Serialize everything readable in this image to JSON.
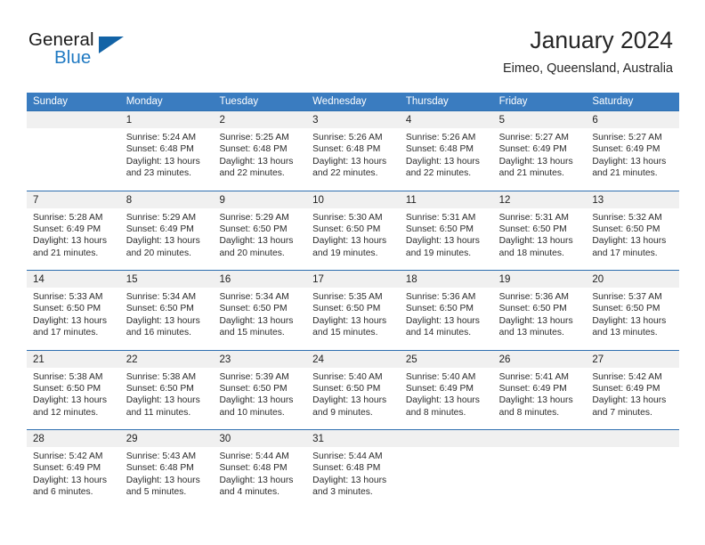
{
  "brand": {
    "word1": "General",
    "word2": "Blue",
    "flag_icon": "triangle-flag-icon",
    "colors": {
      "blue": "#1f79c2",
      "dark_blue": "#1263a6"
    }
  },
  "header": {
    "title": "January 2024",
    "subtitle": "Eimeo, Queensland, Australia"
  },
  "theme": {
    "header_blue": "#3a7cc0",
    "row_border_blue": "#2e6fb0",
    "day_head_gray": "#f0f0f0"
  },
  "weekdays": [
    "Sunday",
    "Monday",
    "Tuesday",
    "Wednesday",
    "Thursday",
    "Friday",
    "Saturday"
  ],
  "weeks": [
    [
      {
        "day": "",
        "sunrise": "",
        "sunset": "",
        "daylight_line1": "",
        "daylight_line2": "",
        "empty": true
      },
      {
        "day": "1",
        "sunrise": "Sunrise: 5:24 AM",
        "sunset": "Sunset: 6:48 PM",
        "daylight_line1": "Daylight: 13 hours",
        "daylight_line2": "and 23 minutes."
      },
      {
        "day": "2",
        "sunrise": "Sunrise: 5:25 AM",
        "sunset": "Sunset: 6:48 PM",
        "daylight_line1": "Daylight: 13 hours",
        "daylight_line2": "and 22 minutes."
      },
      {
        "day": "3",
        "sunrise": "Sunrise: 5:26 AM",
        "sunset": "Sunset: 6:48 PM",
        "daylight_line1": "Daylight: 13 hours",
        "daylight_line2": "and 22 minutes."
      },
      {
        "day": "4",
        "sunrise": "Sunrise: 5:26 AM",
        "sunset": "Sunset: 6:48 PM",
        "daylight_line1": "Daylight: 13 hours",
        "daylight_line2": "and 22 minutes."
      },
      {
        "day": "5",
        "sunrise": "Sunrise: 5:27 AM",
        "sunset": "Sunset: 6:49 PM",
        "daylight_line1": "Daylight: 13 hours",
        "daylight_line2": "and 21 minutes."
      },
      {
        "day": "6",
        "sunrise": "Sunrise: 5:27 AM",
        "sunset": "Sunset: 6:49 PM",
        "daylight_line1": "Daylight: 13 hours",
        "daylight_line2": "and 21 minutes."
      }
    ],
    [
      {
        "day": "7",
        "sunrise": "Sunrise: 5:28 AM",
        "sunset": "Sunset: 6:49 PM",
        "daylight_line1": "Daylight: 13 hours",
        "daylight_line2": "and 21 minutes."
      },
      {
        "day": "8",
        "sunrise": "Sunrise: 5:29 AM",
        "sunset": "Sunset: 6:49 PM",
        "daylight_line1": "Daylight: 13 hours",
        "daylight_line2": "and 20 minutes."
      },
      {
        "day": "9",
        "sunrise": "Sunrise: 5:29 AM",
        "sunset": "Sunset: 6:50 PM",
        "daylight_line1": "Daylight: 13 hours",
        "daylight_line2": "and 20 minutes."
      },
      {
        "day": "10",
        "sunrise": "Sunrise: 5:30 AM",
        "sunset": "Sunset: 6:50 PM",
        "daylight_line1": "Daylight: 13 hours",
        "daylight_line2": "and 19 minutes."
      },
      {
        "day": "11",
        "sunrise": "Sunrise: 5:31 AM",
        "sunset": "Sunset: 6:50 PM",
        "daylight_line1": "Daylight: 13 hours",
        "daylight_line2": "and 19 minutes."
      },
      {
        "day": "12",
        "sunrise": "Sunrise: 5:31 AM",
        "sunset": "Sunset: 6:50 PM",
        "daylight_line1": "Daylight: 13 hours",
        "daylight_line2": "and 18 minutes."
      },
      {
        "day": "13",
        "sunrise": "Sunrise: 5:32 AM",
        "sunset": "Sunset: 6:50 PM",
        "daylight_line1": "Daylight: 13 hours",
        "daylight_line2": "and 17 minutes."
      }
    ],
    [
      {
        "day": "14",
        "sunrise": "Sunrise: 5:33 AM",
        "sunset": "Sunset: 6:50 PM",
        "daylight_line1": "Daylight: 13 hours",
        "daylight_line2": "and 17 minutes."
      },
      {
        "day": "15",
        "sunrise": "Sunrise: 5:34 AM",
        "sunset": "Sunset: 6:50 PM",
        "daylight_line1": "Daylight: 13 hours",
        "daylight_line2": "and 16 minutes."
      },
      {
        "day": "16",
        "sunrise": "Sunrise: 5:34 AM",
        "sunset": "Sunset: 6:50 PM",
        "daylight_line1": "Daylight: 13 hours",
        "daylight_line2": "and 15 minutes."
      },
      {
        "day": "17",
        "sunrise": "Sunrise: 5:35 AM",
        "sunset": "Sunset: 6:50 PM",
        "daylight_line1": "Daylight: 13 hours",
        "daylight_line2": "and 15 minutes."
      },
      {
        "day": "18",
        "sunrise": "Sunrise: 5:36 AM",
        "sunset": "Sunset: 6:50 PM",
        "daylight_line1": "Daylight: 13 hours",
        "daylight_line2": "and 14 minutes."
      },
      {
        "day": "19",
        "sunrise": "Sunrise: 5:36 AM",
        "sunset": "Sunset: 6:50 PM",
        "daylight_line1": "Daylight: 13 hours",
        "daylight_line2": "and 13 minutes."
      },
      {
        "day": "20",
        "sunrise": "Sunrise: 5:37 AM",
        "sunset": "Sunset: 6:50 PM",
        "daylight_line1": "Daylight: 13 hours",
        "daylight_line2": "and 13 minutes."
      }
    ],
    [
      {
        "day": "21",
        "sunrise": "Sunrise: 5:38 AM",
        "sunset": "Sunset: 6:50 PM",
        "daylight_line1": "Daylight: 13 hours",
        "daylight_line2": "and 12 minutes."
      },
      {
        "day": "22",
        "sunrise": "Sunrise: 5:38 AM",
        "sunset": "Sunset: 6:50 PM",
        "daylight_line1": "Daylight: 13 hours",
        "daylight_line2": "and 11 minutes."
      },
      {
        "day": "23",
        "sunrise": "Sunrise: 5:39 AM",
        "sunset": "Sunset: 6:50 PM",
        "daylight_line1": "Daylight: 13 hours",
        "daylight_line2": "and 10 minutes."
      },
      {
        "day": "24",
        "sunrise": "Sunrise: 5:40 AM",
        "sunset": "Sunset: 6:50 PM",
        "daylight_line1": "Daylight: 13 hours",
        "daylight_line2": "and 9 minutes."
      },
      {
        "day": "25",
        "sunrise": "Sunrise: 5:40 AM",
        "sunset": "Sunset: 6:49 PM",
        "daylight_line1": "Daylight: 13 hours",
        "daylight_line2": "and 8 minutes."
      },
      {
        "day": "26",
        "sunrise": "Sunrise: 5:41 AM",
        "sunset": "Sunset: 6:49 PM",
        "daylight_line1": "Daylight: 13 hours",
        "daylight_line2": "and 8 minutes."
      },
      {
        "day": "27",
        "sunrise": "Sunrise: 5:42 AM",
        "sunset": "Sunset: 6:49 PM",
        "daylight_line1": "Daylight: 13 hours",
        "daylight_line2": "and 7 minutes."
      }
    ],
    [
      {
        "day": "28",
        "sunrise": "Sunrise: 5:42 AM",
        "sunset": "Sunset: 6:49 PM",
        "daylight_line1": "Daylight: 13 hours",
        "daylight_line2": "and 6 minutes."
      },
      {
        "day": "29",
        "sunrise": "Sunrise: 5:43 AM",
        "sunset": "Sunset: 6:48 PM",
        "daylight_line1": "Daylight: 13 hours",
        "daylight_line2": "and 5 minutes."
      },
      {
        "day": "30",
        "sunrise": "Sunrise: 5:44 AM",
        "sunset": "Sunset: 6:48 PM",
        "daylight_line1": "Daylight: 13 hours",
        "daylight_line2": "and 4 minutes."
      },
      {
        "day": "31",
        "sunrise": "Sunrise: 5:44 AM",
        "sunset": "Sunset: 6:48 PM",
        "daylight_line1": "Daylight: 13 hours",
        "daylight_line2": "and 3 minutes."
      },
      {
        "day": "",
        "sunrise": "",
        "sunset": "",
        "daylight_line1": "",
        "daylight_line2": "",
        "empty": true
      },
      {
        "day": "",
        "sunrise": "",
        "sunset": "",
        "daylight_line1": "",
        "daylight_line2": "",
        "empty": true
      },
      {
        "day": "",
        "sunrise": "",
        "sunset": "",
        "daylight_line1": "",
        "daylight_line2": "",
        "empty": true
      }
    ]
  ]
}
